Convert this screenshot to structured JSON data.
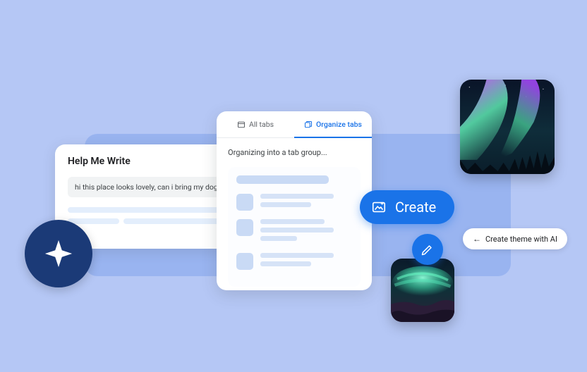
{
  "write_card": {
    "title": "Help Me Write",
    "input_text": "hi this place looks lovely, can i bring my dog"
  },
  "organize_card": {
    "tab_all": "All tabs",
    "tab_organize": "Organize tabs",
    "status": "Organizing into a tab group..."
  },
  "create_button": {
    "label": "Create"
  },
  "theme_pill": {
    "arrow": "←",
    "label": "Create theme with AI"
  },
  "colors": {
    "primary": "#1a73e8",
    "star_bg": "#1b3a77"
  }
}
